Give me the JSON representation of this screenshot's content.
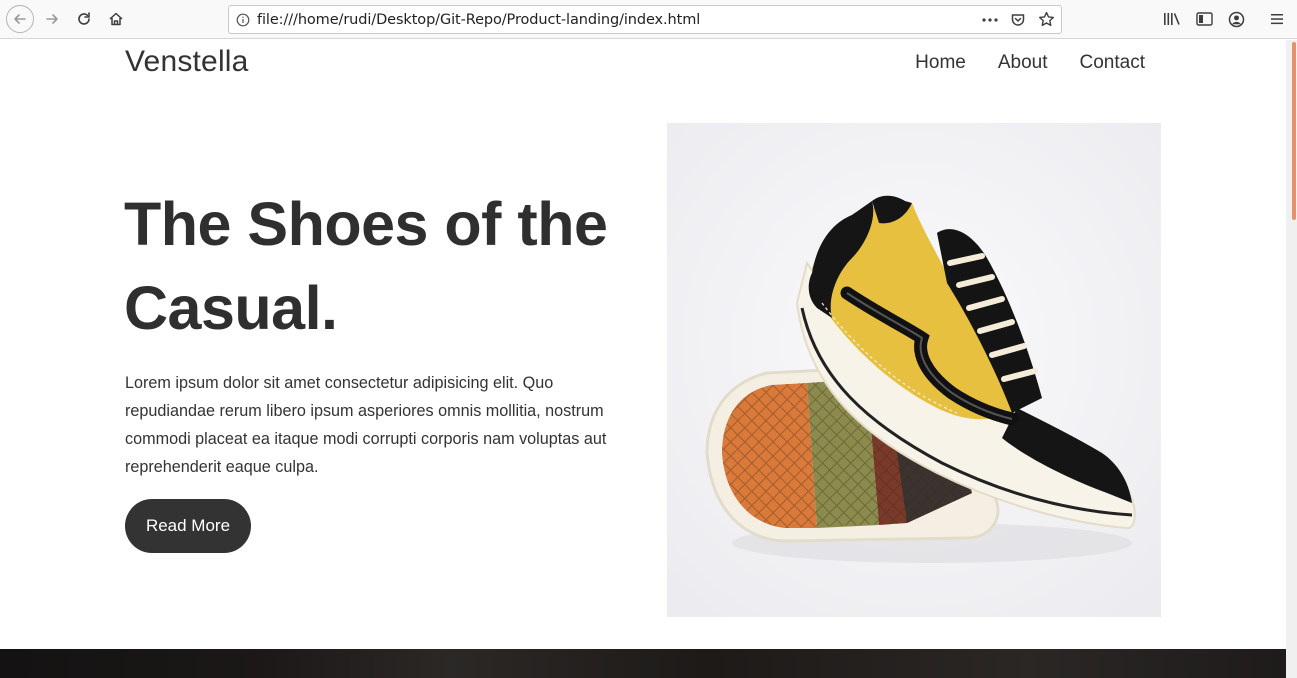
{
  "browser": {
    "url": "file:///home/rudi/Desktop/Git-Repo/Product-landing/index.html",
    "icons": {
      "back": "arrow-left-icon",
      "forward": "arrow-right-icon",
      "reload": "reload-icon",
      "home": "home-icon",
      "info": "info-icon",
      "more": "more-icon",
      "pocket": "pocket-icon",
      "bookmark": "star-icon",
      "library": "library-icon",
      "sidebar": "sidebar-icon",
      "account": "account-icon",
      "menu": "hamburger-menu-icon"
    }
  },
  "site": {
    "brand": "Venstella",
    "nav": [
      "Home",
      "About",
      "Contact"
    ],
    "hero": {
      "title": "The Shoes of the Casual.",
      "text": "Lorem ipsum dolor sit amet consectetur adipisicing elit. Quo repudiandae rerum libero ipsum asperiores omnis mollitia, nostrum commodi placeat ea itaque modi corrupti corporis nam voluptas aut reprehenderit eaque culpa.",
      "button": "Read More",
      "image_alt": "sneaker-image"
    }
  },
  "colors": {
    "text": "#333333",
    "button_bg": "#333333",
    "button_text": "#ffffff",
    "scrollbar_accent": "#e5926b",
    "shoe_yellow": "#e8c040"
  }
}
